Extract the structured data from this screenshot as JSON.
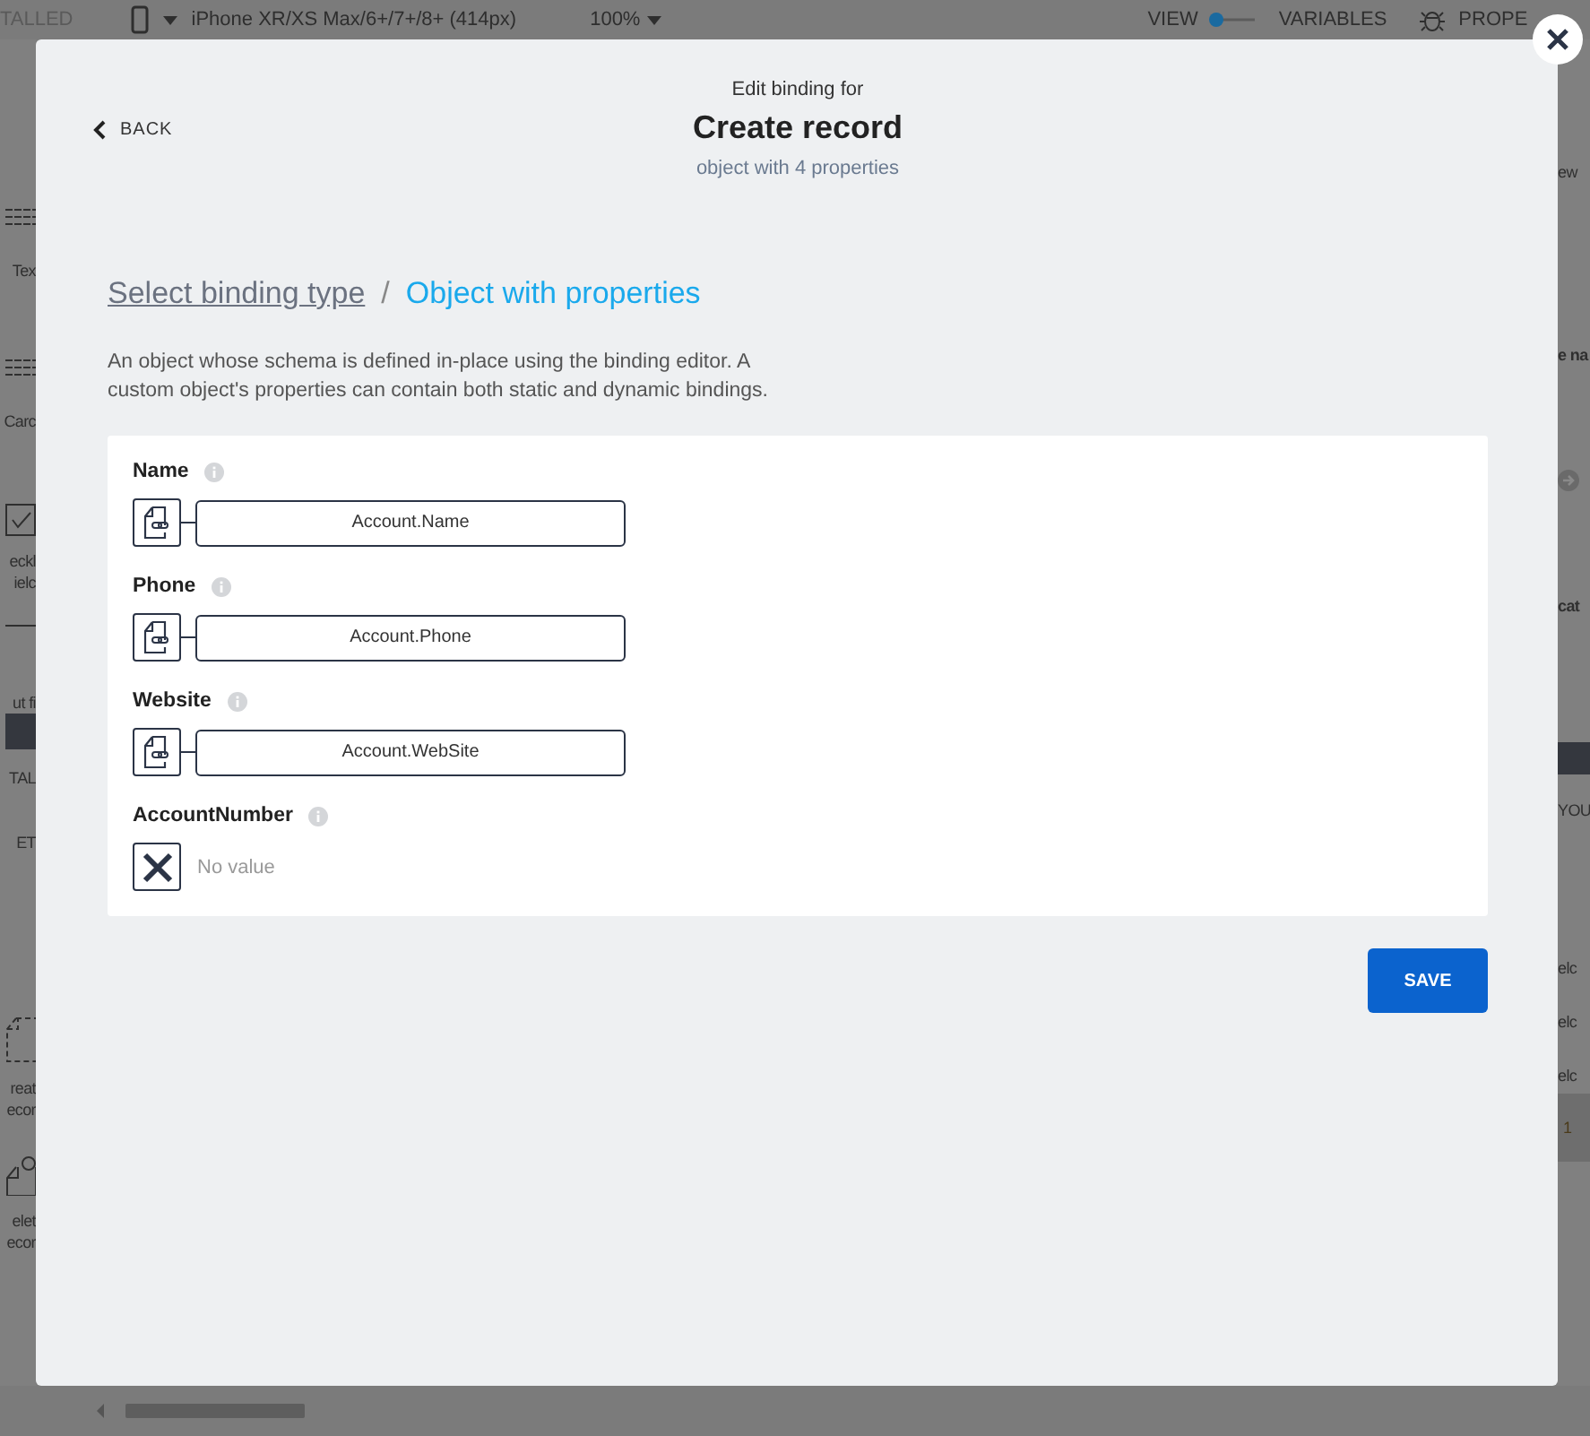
{
  "toolbar": {
    "status": "TALLED",
    "device": "iPhone XR/XS Max/6+/7+/8+ (414px)",
    "zoom": "100%",
    "view_label": "VIEW",
    "view_toggle": {
      "on": true
    },
    "variables": "VARIABLES",
    "panel_title": "PROPE"
  },
  "left_panel": [
    {
      "kind": "tile",
      "lines": [
        "Tex"
      ]
    },
    {
      "kind": "tile",
      "lines": [
        "Carc"
      ]
    },
    {
      "kind": "check",
      "lines": [
        "eckl",
        "ielc"
      ]
    },
    {
      "kind": "input",
      "lines": [
        "ut fi"
      ]
    },
    {
      "kind": "header",
      "lines": [
        "TAL"
      ]
    },
    {
      "kind": "header",
      "lines": [
        "ET"
      ]
    },
    {
      "kind": "create",
      "lines": [
        "reat",
        "ecor"
      ]
    },
    {
      "kind": "delete",
      "lines": [
        "elet",
        "ecor"
      ]
    }
  ],
  "right_panel": [
    {
      "kind": "text",
      "label": "ew"
    },
    {
      "kind": "bold",
      "label": "e na"
    },
    {
      "kind": "arrow"
    },
    {
      "kind": "bold",
      "label": "cat"
    },
    {
      "kind": "section",
      "label": "YOU"
    },
    {
      "kind": "text",
      "label": "elc"
    },
    {
      "kind": "text",
      "label": "elc"
    },
    {
      "kind": "text",
      "label": "elc"
    },
    {
      "kind": "row",
      "label": "1"
    }
  ],
  "modal": {
    "back": "BACK",
    "subtitle": "Edit binding for",
    "title": "Create record",
    "summary": "object with 4 properties",
    "breadcrumb": [
      {
        "label": "Select binding type",
        "selected": false
      },
      {
        "label": "Object with properties",
        "selected": true
      }
    ],
    "separator": "/",
    "description": "An object whose schema is defined in-place using the binding editor. A custom object's properties can contain both static and dynamic bindings.",
    "fields": [
      {
        "label": "Name",
        "kind": "binding",
        "value": "Account.Name"
      },
      {
        "label": "Phone",
        "kind": "binding",
        "value": "Account.Phone"
      },
      {
        "label": "Website",
        "kind": "binding",
        "value": "Account.WebSite"
      },
      {
        "label": "AccountNumber",
        "kind": "empty",
        "value": "No value"
      }
    ],
    "save": "SAVE"
  }
}
